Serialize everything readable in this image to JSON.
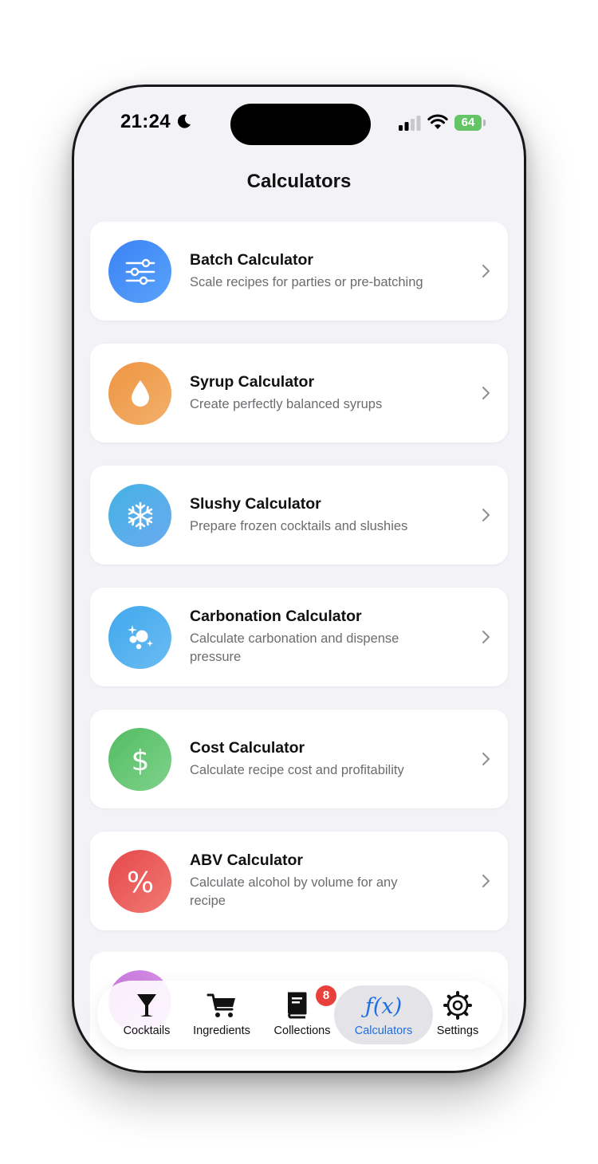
{
  "status_bar": {
    "time": "21:24",
    "battery_level": "64",
    "icons": [
      "moon-icon",
      "cellular-signal-icon",
      "wifi-icon",
      "battery-charging-icon"
    ]
  },
  "page": {
    "title": "Calculators"
  },
  "calculators": [
    {
      "title": "Batch Calculator",
      "subtitle": "Scale recipes for parties or pre-batching",
      "icon": "sliders-icon",
      "color": "#3f87f5"
    },
    {
      "title": "Syrup Calculator",
      "subtitle": "Create perfectly balanced syrups",
      "icon": "droplet-icon",
      "color": "#ee9a45"
    },
    {
      "title": "Slushy Calculator",
      "subtitle": "Prepare frozen cocktails and slushies",
      "icon": "snowflake-icon",
      "color": "#4fb4e6"
    },
    {
      "title": "Carbonation Calculator",
      "subtitle": "Calculate carbonation and dispense pressure",
      "icon": "bubbles-icon",
      "color": "#4fb0ee"
    },
    {
      "title": "Cost Calculator",
      "subtitle": "Calculate recipe cost and profitability",
      "icon": "dollar-icon",
      "color": "#5cc46a"
    },
    {
      "title": "ABV Calculator",
      "subtitle": "Calculate alcohol by volume for any recipe",
      "icon": "percent-icon",
      "color": "#e8534f"
    }
  ],
  "tabbar": {
    "tabs": [
      {
        "label": "Cocktails",
        "icon": "cocktail-glass-icon",
        "active": false
      },
      {
        "label": "Ingredients",
        "icon": "cart-icon",
        "active": false
      },
      {
        "label": "Collections",
        "icon": "book-icon",
        "active": false,
        "badge": "8"
      },
      {
        "label": "Calculators",
        "icon": "function-icon",
        "active": true
      },
      {
        "label": "Settings",
        "icon": "gear-icon",
        "active": false
      }
    ],
    "active_color": "#1e6fe0"
  }
}
